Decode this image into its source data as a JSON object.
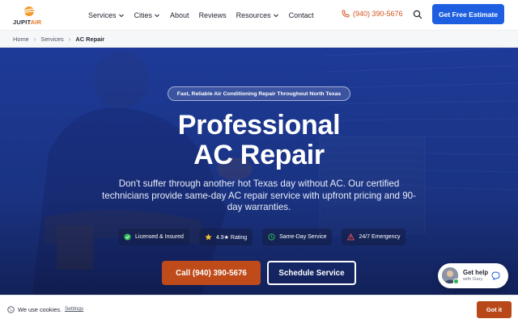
{
  "brand": {
    "name_part1": "JUPIT",
    "name_part2": "AIR",
    "accent_color": "#e8741f"
  },
  "nav": {
    "items": [
      {
        "label": "Services",
        "dropdown": true
      },
      {
        "label": "Cities",
        "dropdown": true
      },
      {
        "label": "About",
        "dropdown": false
      },
      {
        "label": "Reviews",
        "dropdown": false
      },
      {
        "label": "Resources",
        "dropdown": true
      },
      {
        "label": "Contact",
        "dropdown": false
      }
    ],
    "phone": "(940) 390-5676",
    "cta_label": "Get Free Estimate",
    "cta_color": "#1d5fe0"
  },
  "breadcrumb": {
    "items": [
      "Home",
      "Services"
    ],
    "current": "AC Repair"
  },
  "hero": {
    "tag": "Fast, Reliable Air Conditioning Repair Throughout North Texas",
    "title_line1": "Professional",
    "title_line2": "AC Repair",
    "subtitle": "Don't suffer through another hot Texas day without AC. Our certified technicians provide same-day AC repair service with upfront pricing and 90-day warranties.",
    "badges": [
      {
        "icon": "check-circle-icon",
        "label": "Licensed & Insured"
      },
      {
        "icon": "star-icon",
        "label": "4.9★ Rating"
      },
      {
        "icon": "clock-icon",
        "label": "Same-Day Service"
      },
      {
        "icon": "alert-triangle-icon",
        "label": "24/7 Emergency"
      }
    ],
    "call_button": "Call (940) 390-5676",
    "schedule_button": "Schedule Service",
    "call_color": "#bf4a1a"
  },
  "chat": {
    "title": "Get help",
    "subtitle": "with Gary"
  },
  "cookie": {
    "text": "We use cookies.",
    "settings_link": "Settings",
    "accept_button": "Got it"
  }
}
